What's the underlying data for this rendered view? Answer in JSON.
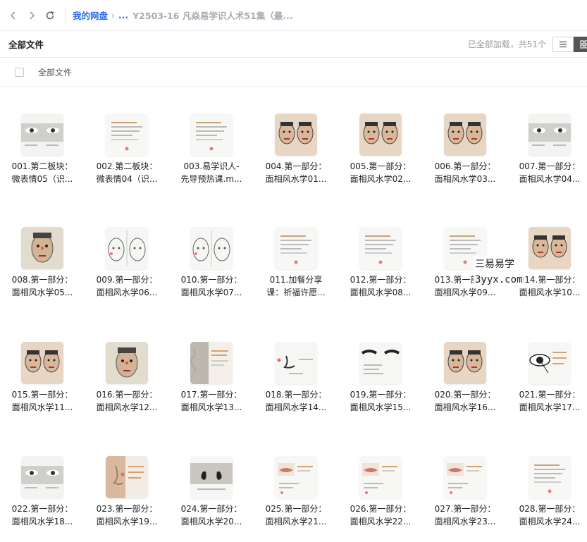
{
  "breadcrumb": {
    "root": "我的网盘",
    "ellipsis": "...",
    "current": "Y2503-16 凡焱易学识人术51集（最..."
  },
  "header": {
    "title": "全部文件",
    "status": "已全部加载，共51个"
  },
  "select_all": {
    "label": "全部文件"
  },
  "watermark": {
    "line1": "三易易学",
    "line2": "3yyx.com"
  },
  "files": [
    {
      "l1": "001.第二板块：",
      "l2": "微表情05（识...",
      "thumb": "eyes"
    },
    {
      "l1": "002.第二板块：",
      "l2": "微表情04（识...",
      "thumb": "text"
    },
    {
      "l1": "003.易学识人-",
      "l2": "先导预热课.m...",
      "thumb": "text"
    },
    {
      "l1": "004.第一部分：",
      "l2": "面相风水学01...",
      "thumb": "faces"
    },
    {
      "l1": "005.第一部分：",
      "l2": "面相风水学02...",
      "thumb": "faces"
    },
    {
      "l1": "006.第一部分：",
      "l2": "面相风水学03...",
      "thumb": "faces"
    },
    {
      "l1": "007.第一部分：",
      "l2": "面相风水学04...",
      "thumb": "eyes"
    },
    {
      "l1": "008.第一部分：",
      "l2": "面相风水学05...",
      "thumb": "face"
    },
    {
      "l1": "009.第一部分：",
      "l2": "面相风水学06...",
      "thumb": "sketch"
    },
    {
      "l1": "010.第一部分：",
      "l2": "面相风水学07...",
      "thumb": "sketch"
    },
    {
      "l1": "011.加餐分享",
      "l2": "课：祈福许愿...",
      "thumb": "text"
    },
    {
      "l1": "012.第一部分：",
      "l2": "面相风水学08...",
      "thumb": "text"
    },
    {
      "l1": "013.第一部分：",
      "l2": "面相风水学09...",
      "thumb": "text"
    },
    {
      "l1": "014.第一部分：",
      "l2": "面相风水学10...",
      "thumb": "faces"
    },
    {
      "l1": "015.第一部分：",
      "l2": "面相风水学11...",
      "thumb": "faces"
    },
    {
      "l1": "016.第一部分：",
      "l2": "面相风水学12...",
      "thumb": "face"
    },
    {
      "l1": "017.第一部分：",
      "l2": "面相风水学13...",
      "thumb": "texture"
    },
    {
      "l1": "018.第一部分：",
      "l2": "面相风水学14...",
      "thumb": "nose"
    },
    {
      "l1": "019.第一部分：",
      "l2": "面相风水学15...",
      "thumb": "brows"
    },
    {
      "l1": "020.第一部分：",
      "l2": "面相风水学16...",
      "thumb": "faces"
    },
    {
      "l1": "021.第一部分：",
      "l2": "面相风水学17...",
      "thumb": "eye"
    },
    {
      "l1": "022.第一部分：",
      "l2": "面相风水学18...",
      "thumb": "eyes"
    },
    {
      "l1": "023.第一部分：",
      "l2": "面相风水学19...",
      "thumb": "skin"
    },
    {
      "l1": "024.第一部分：",
      "l2": "面相风水学20...",
      "thumb": "nostrils"
    },
    {
      "l1": "025.第一部分：",
      "l2": "面相风水学21...",
      "thumb": "lips"
    },
    {
      "l1": "026.第一部分：",
      "l2": "面相风水学22...",
      "thumb": "lips"
    },
    {
      "l1": "027.第一部分：",
      "l2": "面相风水学23...",
      "thumb": "lips"
    },
    {
      "l1": "028.第一部分：",
      "l2": "面相风水学24...",
      "thumb": "text"
    }
  ]
}
